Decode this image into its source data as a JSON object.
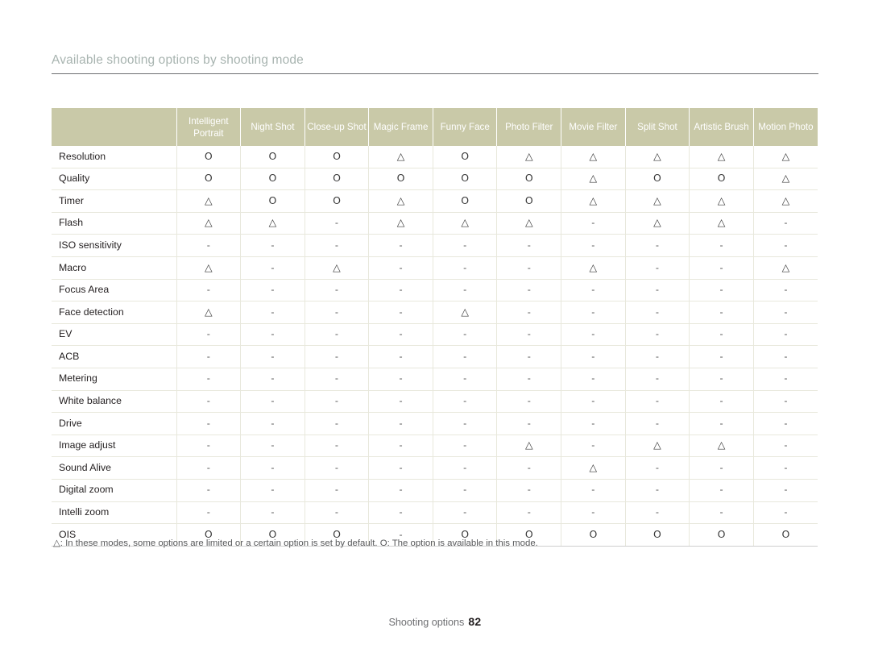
{
  "heading": "Available shooting options by shooting mode",
  "table": {
    "corner_label": "",
    "columns": [
      "Intelligent Portrait",
      "Night Shot",
      "Close-up Shot",
      "Magic Frame",
      "Funny Face",
      "Photo Filter",
      "Movie Filter",
      "Split Shot",
      "Artistic Brush",
      "Motion Photo"
    ],
    "rows": [
      {
        "label": "Resolution",
        "cells": [
          "O",
          "O",
          "O",
          "△",
          "O",
          "△",
          "△",
          "△",
          "△",
          "△"
        ]
      },
      {
        "label": "Quality",
        "cells": [
          "O",
          "O",
          "O",
          "O",
          "O",
          "O",
          "△",
          "O",
          "O",
          "△"
        ]
      },
      {
        "label": "Timer",
        "cells": [
          "△",
          "O",
          "O",
          "△",
          "O",
          "O",
          "△",
          "△",
          "△",
          "△"
        ]
      },
      {
        "label": "Flash",
        "cells": [
          "△",
          "△",
          "-",
          "△",
          "△",
          "△",
          "-",
          "△",
          "△",
          "-"
        ]
      },
      {
        "label": "ISO sensitivity",
        "cells": [
          "-",
          "-",
          "-",
          "-",
          "-",
          "-",
          "-",
          "-",
          "-",
          "-"
        ]
      },
      {
        "label": "Macro",
        "cells": [
          "△",
          "-",
          "△",
          "-",
          "-",
          "-",
          "△",
          "-",
          "-",
          "△"
        ]
      },
      {
        "label": "Focus Area",
        "cells": [
          "-",
          "-",
          "-",
          "-",
          "-",
          "-",
          "-",
          "-",
          "-",
          "-"
        ]
      },
      {
        "label": "Face detection",
        "cells": [
          "△",
          "-",
          "-",
          "-",
          "△",
          "-",
          "-",
          "-",
          "-",
          "-"
        ]
      },
      {
        "label": "EV",
        "cells": [
          "-",
          "-",
          "-",
          "-",
          "-",
          "-",
          "-",
          "-",
          "-",
          "-"
        ]
      },
      {
        "label": "ACB",
        "cells": [
          "-",
          "-",
          "-",
          "-",
          "-",
          "-",
          "-",
          "-",
          "-",
          "-"
        ]
      },
      {
        "label": "Metering",
        "cells": [
          "-",
          "-",
          "-",
          "-",
          "-",
          "-",
          "-",
          "-",
          "-",
          "-"
        ]
      },
      {
        "label": "White balance",
        "cells": [
          "-",
          "-",
          "-",
          "-",
          "-",
          "-",
          "-",
          "-",
          "-",
          "-"
        ]
      },
      {
        "label": "Drive",
        "cells": [
          "-",
          "-",
          "-",
          "-",
          "-",
          "-",
          "-",
          "-",
          "-",
          "-"
        ]
      },
      {
        "label": "Image adjust",
        "cells": [
          "-",
          "-",
          "-",
          "-",
          "-",
          "△",
          "-",
          "△",
          "△",
          "-"
        ]
      },
      {
        "label": "Sound Alive",
        "cells": [
          "-",
          "-",
          "-",
          "-",
          "-",
          "-",
          "△",
          "-",
          "-",
          "-"
        ]
      },
      {
        "label": "Digital zoom",
        "cells": [
          "-",
          "-",
          "-",
          "-",
          "-",
          "-",
          "-",
          "-",
          "-",
          "-"
        ]
      },
      {
        "label": "Intelli zoom",
        "cells": [
          "-",
          "-",
          "-",
          "-",
          "-",
          "-",
          "-",
          "-",
          "-",
          "-"
        ]
      },
      {
        "label": "OIS",
        "cells": [
          "O",
          "O",
          "O",
          "-",
          "O",
          "O",
          "O",
          "O",
          "O",
          "O"
        ]
      }
    ]
  },
  "footnote": "△: In these modes, some options are limited or a certain option is set by default. O: The option is available in this mode.",
  "footer": {
    "label": "Shooting options",
    "page": "82"
  },
  "colors": {
    "header_bg": "#c9c9a8",
    "heading_text": "#a8b4b0",
    "body_text": "#231f20",
    "grid_line": "#e8e8dc"
  }
}
